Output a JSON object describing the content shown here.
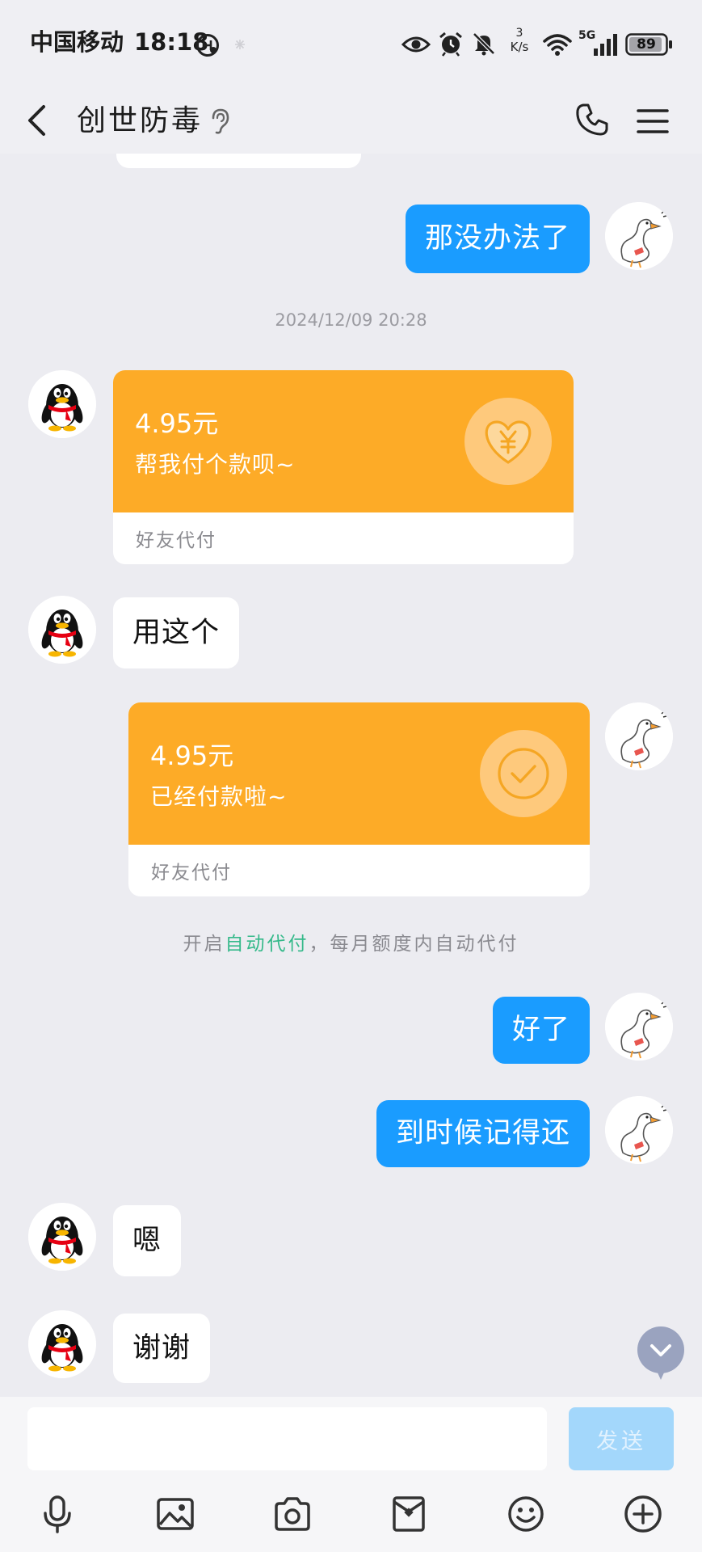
{
  "status_bar": {
    "carrier": "中国移动",
    "time": "18:18",
    "net_speed": {
      "value": "3",
      "unit": "K/s"
    },
    "network_type": "5G",
    "battery": "89",
    "icons": [
      "app-status-icon",
      "snowflake-icon",
      "eye-icon",
      "alarm-icon",
      "bell-off-icon",
      "wifi-icon",
      "signal-icon",
      "battery-icon"
    ]
  },
  "header": {
    "title": "创世防毒",
    "icons": {
      "back": "chevron-left-icon",
      "mode": "ear-icon",
      "call": "phone-icon",
      "menu": "menu-icon"
    }
  },
  "messages": {
    "sent_1": "那没办法了",
    "timestamp": "2024/12/09 20:28",
    "payment_request": {
      "amount": "4.95元",
      "note": "帮我付个款呗~",
      "footer": "好友代付",
      "icon": "heart-yen-icon"
    },
    "received_1": "用这个",
    "payment_paid": {
      "amount": "4.95元",
      "note": "已经付款啦~",
      "footer": "好友代付",
      "icon": "check-circle-icon"
    },
    "system_notice": {
      "prefix": "开启",
      "link": "自动代付",
      "suffix": "，每月额度内自动代付"
    },
    "sent_2": "好了",
    "sent_3": "到时候记得还",
    "received_2": "嗯",
    "received_3": "谢谢"
  },
  "avatars": {
    "contact": "penguin-avatar",
    "self": "goose-avatar"
  },
  "composer": {
    "input_value": "",
    "placeholder": "",
    "send_label": "发送"
  },
  "toolbar": {
    "icons": [
      "microphone-icon",
      "image-icon",
      "camera-icon",
      "red-packet-icon",
      "emoji-icon",
      "plus-circle-icon"
    ]
  },
  "colors": {
    "accent_blue": "#1a9cff",
    "card_orange": "#fdab27",
    "link_green": "#35b98a",
    "send_button_disabled": "#a3d7fb",
    "chat_background": "#ececf1"
  }
}
